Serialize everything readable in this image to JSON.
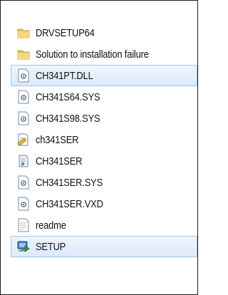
{
  "files": [
    {
      "name": "DRVSETUP64",
      "icon": "folder-icon",
      "selected": false
    },
    {
      "name": "Solution to installation failure",
      "icon": "folder-icon",
      "selected": false
    },
    {
      "name": "CH341PT.DLL",
      "icon": "system-file-icon",
      "selected": true
    },
    {
      "name": "CH341S64.SYS",
      "icon": "system-file-icon",
      "selected": false
    },
    {
      "name": "CH341S98.SYS",
      "icon": "system-file-icon",
      "selected": false
    },
    {
      "name": "ch341SER",
      "icon": "setup-information-icon",
      "selected": false
    },
    {
      "name": "CH341SER",
      "icon": "security-catalog-icon",
      "selected": false
    },
    {
      "name": "CH341SER.SYS",
      "icon": "system-file-icon",
      "selected": false
    },
    {
      "name": "CH341SER.VXD",
      "icon": "system-file-icon",
      "selected": false
    },
    {
      "name": "readme",
      "icon": "text-document-icon",
      "selected": false
    },
    {
      "name": "SETUP",
      "icon": "setup-application-icon",
      "selected": true
    }
  ],
  "colors": {
    "selection_bg": "#dceafb",
    "selection_border": "#9fc4ea",
    "folder": "#e8c05a"
  }
}
